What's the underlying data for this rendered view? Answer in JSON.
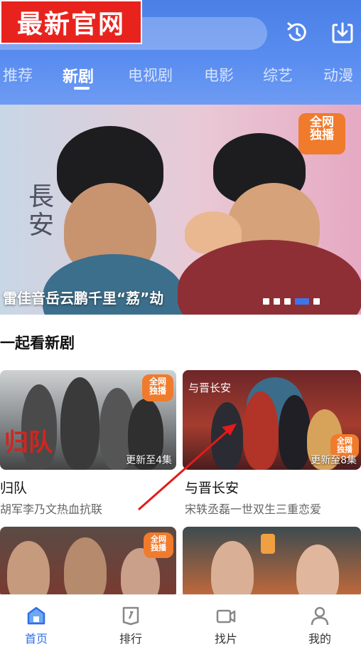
{
  "header": {
    "logo_text": "最新官网",
    "icons": [
      "history-icon",
      "download-icon"
    ]
  },
  "tabs": [
    {
      "label": "推荐"
    },
    {
      "label": "新剧",
      "active": true
    },
    {
      "label": "电视剧"
    },
    {
      "label": "电影"
    },
    {
      "label": "综艺"
    },
    {
      "label": "动漫"
    }
  ],
  "banner": {
    "caption": "雷佳音岳云鹏千里“荔”劫",
    "badge": "全网独播",
    "dots_total": 5,
    "dots_active_index": 3
  },
  "section": {
    "title": "一起看新剧"
  },
  "cards": [
    {
      "title": "归队",
      "desc": "胡军李乃文热血抗联",
      "update": "更新至4集",
      "badge": "全网独播"
    },
    {
      "title": "与晋长安",
      "desc": "宋轶丞磊一世双生三重恋爱",
      "update": "更新至8集",
      "badge": "全网独播"
    },
    {
      "title": "",
      "desc": "",
      "update": "",
      "badge": "全网独播"
    },
    {
      "title": "",
      "desc": "",
      "update": "",
      "badge": ""
    }
  ],
  "bottom_nav": [
    {
      "label": "首页",
      "icon": "home-icon",
      "active": true
    },
    {
      "label": "排行",
      "icon": "ranking-icon"
    },
    {
      "label": "找片",
      "icon": "video-camera-icon"
    },
    {
      "label": "我的",
      "icon": "profile-icon"
    }
  ],
  "colors": {
    "header_blue": "#4a7fe6",
    "logo_red": "#e8231e",
    "badge_orange": "#f07b2d",
    "active_blue": "#2f6fe4"
  }
}
